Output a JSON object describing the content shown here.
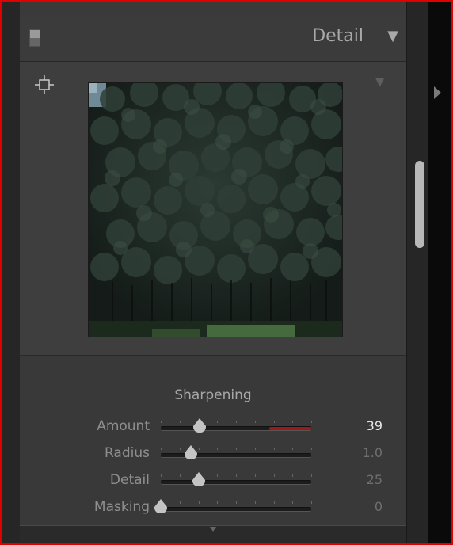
{
  "panel": {
    "title": "Detail",
    "collapse_glyph": "▼",
    "preview_menu_glyph": "▼",
    "target_icon": "crosshair-target-icon",
    "preview_image": "forest-trees-crop"
  },
  "sharpening": {
    "title": "Sharpening",
    "rows": [
      {
        "label": "Amount",
        "value": "39",
        "fraction": 0.26,
        "active": true
      },
      {
        "label": "Radius",
        "value": "1.0",
        "fraction": 0.2,
        "active": false
      },
      {
        "label": "Detail",
        "value": "25",
        "fraction": 0.25,
        "active": false
      },
      {
        "label": "Masking",
        "value": "0",
        "fraction": 0.0,
        "active": false
      }
    ]
  },
  "colors": {
    "accent_red": "#9b1b1b",
    "frame_red": "#e00000"
  }
}
